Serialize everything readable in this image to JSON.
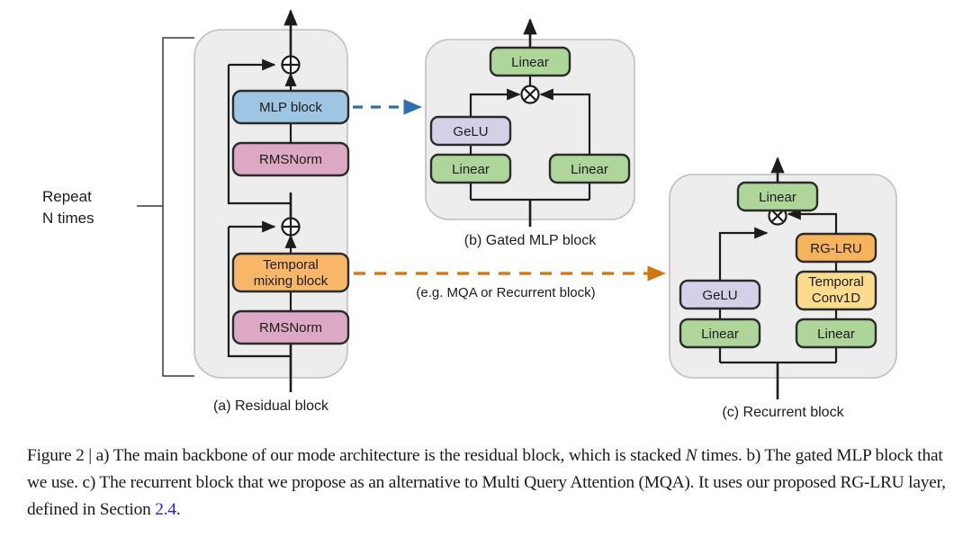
{
  "figure": {
    "panels": [
      {
        "id": "a",
        "caption": "(a) Residual block",
        "caption_color": "#1c1c1c",
        "blocks": [
          {
            "name": "mlp-block",
            "label": "MLP block",
            "color": "#9EC5E2"
          },
          {
            "name": "rmsnorm-upper",
            "label": "RMSNorm",
            "color": "#DCA8C4"
          },
          {
            "name": "temporal-mixing-block",
            "label_line1": "Temporal",
            "label_line2": "mixing block",
            "color": "#F7B668"
          },
          {
            "name": "rmsnorm-lower",
            "label": "RMSNorm",
            "color": "#DCA8C4"
          }
        ],
        "annotation": {
          "line1": "Repeat",
          "line2": "N times"
        },
        "operators": [
          {
            "name": "residual-add-upper",
            "symbol": "plus-circle-icon"
          },
          {
            "name": "residual-add-lower",
            "symbol": "plus-circle-icon"
          }
        ]
      },
      {
        "id": "b",
        "caption": "(b) Gated MLP block",
        "caption_color": "#2E6DB4",
        "blocks": [
          {
            "name": "linear-output",
            "label": "Linear",
            "color": "#AED69B"
          },
          {
            "name": "gelu",
            "label": "GeLU",
            "color": "#D5CFE8"
          },
          {
            "name": "linear-left",
            "label": "Linear",
            "color": "#AED69B"
          },
          {
            "name": "linear-right",
            "label": "Linear",
            "color": "#AED69B"
          }
        ],
        "operators": [
          {
            "name": "elementwise-multiply",
            "symbol": "times-circle-icon"
          }
        ]
      },
      {
        "id": "c",
        "caption": "(c) Recurrent block",
        "caption_color": "#D2750E",
        "blocks": [
          {
            "name": "linear-output",
            "label": "Linear",
            "color": "#AED69B"
          },
          {
            "name": "rg-lru",
            "label": "RG-LRU",
            "color": "#F5B45C"
          },
          {
            "name": "temporal-conv1d",
            "label_line1": "Temporal",
            "label_line2": "Conv1D",
            "color": "#FBDC8E"
          },
          {
            "name": "gelu",
            "label": "GeLU",
            "color": "#D5CFE8"
          },
          {
            "name": "linear-left",
            "label": "Linear",
            "color": "#AED69B"
          },
          {
            "name": "linear-right",
            "label": "Linear",
            "color": "#AED69B"
          }
        ],
        "operators": [
          {
            "name": "elementwise-multiply",
            "symbol": "times-circle-icon"
          }
        ]
      }
    ],
    "connectors": [
      {
        "name": "mlp-to-gated-mlp-connector",
        "style": "dashed-arrow",
        "color": "#2E6DB4",
        "label": ""
      },
      {
        "name": "temporal-to-recurrent-connector",
        "style": "dashed-arrow",
        "color": "#D2750E",
        "label": "(e.g. MQA or Recurrent block)"
      }
    ],
    "colors": {
      "panel_fill": "#EDEDED",
      "panel_stroke": "#BFBFBF",
      "wire": "#1c1c1c",
      "blue_accent": "#2E6DB4",
      "orange_accent": "#D2750E"
    }
  },
  "caption": {
    "prefix": "Figure 2 | ",
    "part1": "a) The main backbone of our mode architecture is the residual block, which is stacked ",
    "italic_n": "N",
    "part2": " times. b) The gated MLP block that we use. c) The recurrent block that we propose as an alternative to Multi Query Attention (MQA). It uses our proposed RG-LRU layer, defined in Section ",
    "section_link": "2.4",
    "suffix": "."
  }
}
